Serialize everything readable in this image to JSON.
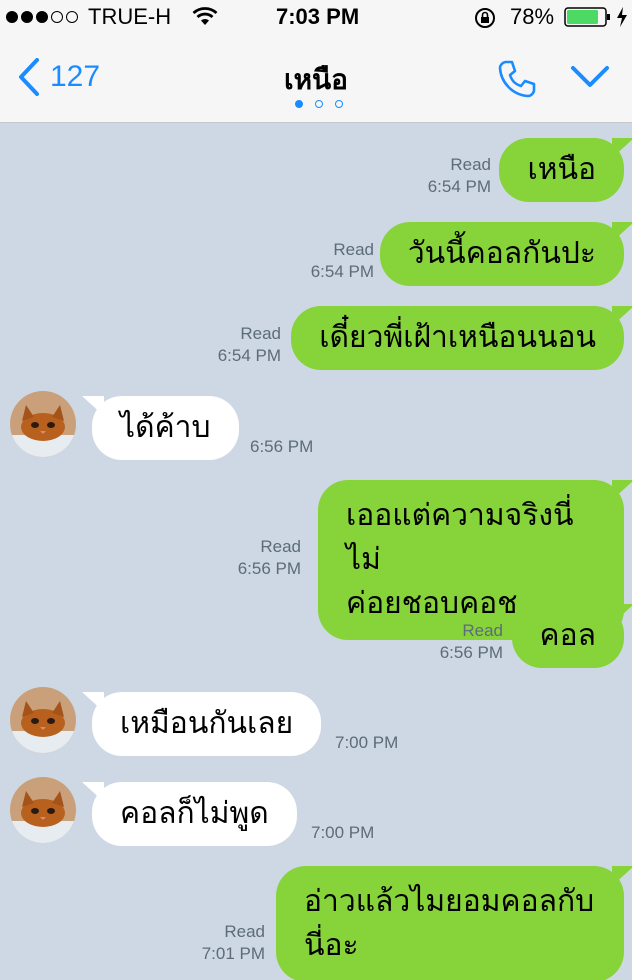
{
  "status_bar": {
    "carrier": "TRUE-H",
    "time": "7:03 PM",
    "battery": "78%"
  },
  "nav": {
    "back_count": "127",
    "title": "เหนือ"
  },
  "colors": {
    "accent": "#1a8cff",
    "outgoing": "#86d33a",
    "incoming": "#ffffff",
    "background": "#ced8e4"
  },
  "messages": [
    {
      "side": "out",
      "text": "เหนือ",
      "status": "Read",
      "time": "6:54 PM"
    },
    {
      "side": "out",
      "text": "วันนี้คอลกันปะ",
      "status": "Read",
      "time": "6:54 PM"
    },
    {
      "side": "out",
      "text": "เดี๋ยวพี่เฝ้าเหนือนนอน",
      "status": "Read",
      "time": "6:54 PM"
    },
    {
      "side": "in",
      "text": "ได้ค้าบ",
      "time": "6:56 PM"
    },
    {
      "side": "out",
      "text_line1": "เออแต่ความจริงนี่ไม่",
      "text_line2": "ค่อยชอบคอช",
      "status": "Read",
      "time": "6:56 PM"
    },
    {
      "side": "out",
      "text": "คอล",
      "status": "Read",
      "time": "6:56 PM"
    },
    {
      "side": "in",
      "text": "เหมือนกันเลย",
      "time": "7:00 PM"
    },
    {
      "side": "in",
      "text": "คอลก็ไม่พูด",
      "time": "7:00 PM"
    },
    {
      "side": "out",
      "text_line1": "อ่าวแล้วไมยอมคอลกับ",
      "text_line2": "นี่อะ",
      "status": "Read",
      "time": "7:01 PM"
    }
  ]
}
